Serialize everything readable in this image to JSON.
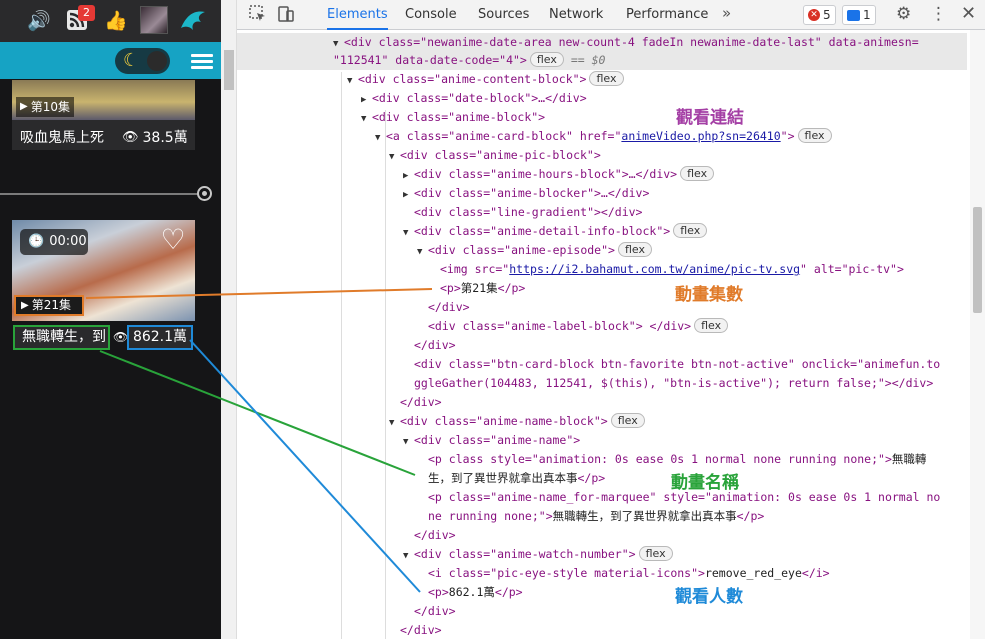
{
  "site": {
    "badge_count": "2",
    "card1": {
      "episode": "第10集",
      "name": "吸血鬼馬上死",
      "views": "38.5萬"
    },
    "card2": {
      "time": "00:00",
      "episode": "第21集",
      "name": "無職轉生，到",
      "views": "862.1萬"
    }
  },
  "devtools": {
    "tabs": [
      "Elements",
      "Console",
      "Sources",
      "Network",
      "Performance"
    ],
    "active_tab": "Elements",
    "more": "»",
    "errors": "5",
    "messages": "1",
    "flex": "flex",
    "dollar": "== $0"
  },
  "tree": {
    "r0a": "<div class=\"newanime-date-area new-count-4   fadeIn newanime-date-last\" data-animesn=",
    "r0b": "\"112541\" data-date-code=\"4\">",
    "r1": "<div class=\"anime-content-block\">",
    "r2": "<div class=\"date-block\">…</div>",
    "r3": "<div class=\"anime-block\">",
    "r4a": "<a class=\"anime-card-block\" href=\"",
    "r4link": "animeVideo.php?sn=26410",
    "r4b": "\">",
    "r5": "<div class=\"anime-pic-block\">",
    "r6": "<div class=\"anime-hours-block\">…</div>",
    "r7": "<div class=\"anime-blocker\">…</div>",
    "r8": "<div class=\"line-gradient\"></div>",
    "r9": "<div class=\"anime-detail-info-block\">",
    "r10": "<div class=\"anime-episode\">",
    "r11a": "<img src=\"",
    "r11link": "https://i2.bahamut.com.tw/anime/pic-tv.svg",
    "r11b": "\" alt=\"pic-tv\">",
    "r12a": "<p>",
    "r12t": "第21集",
    "r12b": "</p>",
    "r13": "</div>",
    "r14": "<div class=\"anime-label-block\"> </div>",
    "r15": "</div>",
    "r16a": "<div class=\"btn-card-block btn-favorite btn-not-active\" onclick=\"animefun.to",
    "r16b": "ggleGather(104483, 112541, $(this), \"btn-is-active\"); return false;\"></div>",
    "r17": "</div>",
    "r18": "<div class=\"anime-name-block\">",
    "r19": "<div class=\"anime-name\">",
    "r20a": "<p class style=\"animation: 0s ease 0s 1 normal none running none;\">",
    "r20t": "無職轉",
    "r20c": "生，到了異世界就拿出真本事",
    "r20d": "</p>",
    "r21a": "<p class=\"anime-name_for-marquee\" style=\"animation: 0s ease 0s 1 normal no",
    "r21b": "ne running none;\">",
    "r21t": "無職轉生，到了異世界就拿出真本事",
    "r21c": "</p>",
    "r22": "</div>",
    "r23": "<div class=\"anime-watch-number\">",
    "r24a": "<i class=\"pic-eye-style material-icons\">",
    "r24t": "remove_red_eye",
    "r24b": "</i>",
    "r25a": "<p>",
    "r25t": "862.1萬",
    "r25b": "</p>",
    "r26": "</div>",
    "r27": "</div>"
  },
  "annotations": {
    "link": "觀看連結",
    "episodes": "動畫集數",
    "name": "動畫名稱",
    "views": "觀看人數"
  },
  "colors": {
    "episodes": "#e07b2a",
    "name": "#29a33a",
    "views": "#1f8ad8",
    "link": "#a43fa5"
  }
}
